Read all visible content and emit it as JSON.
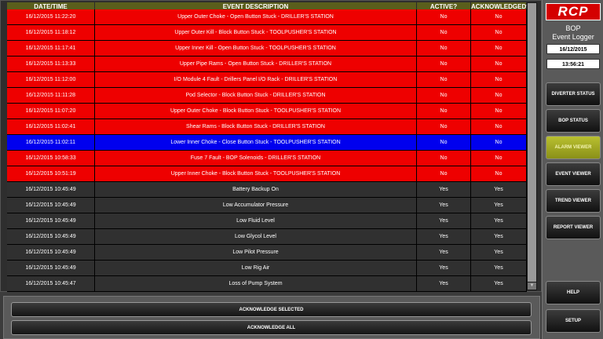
{
  "table": {
    "columns": [
      "DATE/TIME",
      "EVENT DESCRIPTION",
      "ACTIVE?",
      "ACKNOWLEDGED? ▲"
    ],
    "rows": [
      {
        "datetime": "16/12/2015 11:22:20",
        "description": "Upper Outer Choke - Open Button Stuck - DRILLER'S STATION",
        "active": "No",
        "acknowledged": "No",
        "status": "alarm"
      },
      {
        "datetime": "16/12/2015 11:18:12",
        "description": "Upper Outer Kill - Block Button Stuck - TOOLPUSHER'S STATION",
        "active": "No",
        "acknowledged": "No",
        "status": "alarm"
      },
      {
        "datetime": "16/12/2015 11:17:41",
        "description": "Upper Inner Kill - Open Button Stuck - TOOLPUSHER'S STATION",
        "active": "No",
        "acknowledged": "No",
        "status": "alarm"
      },
      {
        "datetime": "16/12/2015 11:13:33",
        "description": "Upper Pipe Rams - Open Button Stuck - DRILLER'S STATION",
        "active": "No",
        "acknowledged": "No",
        "status": "alarm"
      },
      {
        "datetime": "16/12/2015 11:12:00",
        "description": "I/O Module 4 Fault - Drillers Panel I/O Rack - DRILLER'S STATION",
        "active": "No",
        "acknowledged": "No",
        "status": "alarm"
      },
      {
        "datetime": "16/12/2015 11:11:28",
        "description": "Pod Selector - Block Button Stuck - DRILLER'S STATION",
        "active": "No",
        "acknowledged": "No",
        "status": "alarm"
      },
      {
        "datetime": "16/12/2015 11:07:20",
        "description": "Upper Outer Choke - Block Button Stuck - TOOLPUSHER'S STATION",
        "active": "No",
        "acknowledged": "No",
        "status": "alarm"
      },
      {
        "datetime": "16/12/2015 11:02:41",
        "description": "Shear Rams - Block Button Stuck - DRILLER'S STATION",
        "active": "No",
        "acknowledged": "No",
        "status": "alarm"
      },
      {
        "datetime": "16/12/2015 11:02:11",
        "description": "Lower Inner Choke - Close Button Stuck - TOOLPUSHER'S STATION",
        "active": "No",
        "acknowledged": "No",
        "status": "selected"
      },
      {
        "datetime": "16/12/2015 10:58:33",
        "description": "Fuse 7 Fault - BOP Solenoids - DRILLER'S STATION",
        "active": "No",
        "acknowledged": "No",
        "status": "alarm"
      },
      {
        "datetime": "16/12/2015 10:51:19",
        "description": "Upper Inner Choke - Block Button Stuck - TOOLPUSHER'S STATION",
        "active": "No",
        "acknowledged": "No",
        "status": "alarm"
      },
      {
        "datetime": "16/12/2015 10:45:49",
        "description": "Battery Backup On",
        "active": "Yes",
        "acknowledged": "Yes",
        "status": "normal"
      },
      {
        "datetime": "16/12/2015 10:45:49",
        "description": "Low Accumulator Pressure",
        "active": "Yes",
        "acknowledged": "Yes",
        "status": "normal"
      },
      {
        "datetime": "16/12/2015 10:45:49",
        "description": "Low Fluid Level",
        "active": "Yes",
        "acknowledged": "Yes",
        "status": "normal"
      },
      {
        "datetime": "16/12/2015 10:45:49",
        "description": "Low Glycol Level",
        "active": "Yes",
        "acknowledged": "Yes",
        "status": "normal"
      },
      {
        "datetime": "16/12/2015 10:45:49",
        "description": "Low Pilot Pressure",
        "active": "Yes",
        "acknowledged": "Yes",
        "status": "normal"
      },
      {
        "datetime": "16/12/2015 10:45:49",
        "description": "Low Rig Air",
        "active": "Yes",
        "acknowledged": "Yes",
        "status": "normal"
      },
      {
        "datetime": "16/12/2015 10:45:47",
        "description": "Loss of Pump System",
        "active": "Yes",
        "acknowledged": "Yes",
        "status": "normal"
      }
    ]
  },
  "actions": {
    "acknowledge_selected": "ACKNOWLEDGE SELECTED",
    "acknowledge_all": "ACKNOWLEDGE ALL"
  },
  "sidebar": {
    "logo": "RCP",
    "title": "BOP\nEvent Logger",
    "date": "16/12/2015",
    "time": "13:56:21",
    "nav": [
      {
        "label": "DIVERTER STATUS",
        "name": "nav-diverter-status-button",
        "active": false
      },
      {
        "label": "BOP STATUS",
        "name": "nav-bop-status-button",
        "active": false
      },
      {
        "label": "ALARM VIEWER",
        "name": "nav-alarm-viewer-button",
        "active": true
      },
      {
        "label": "EVENT VIEWER",
        "name": "nav-event-viewer-button",
        "active": false
      },
      {
        "label": "TREND VIEWER",
        "name": "nav-trend-viewer-button",
        "active": false
      },
      {
        "label": "REPORT VIEWER",
        "name": "nav-report-viewer-button",
        "active": false
      }
    ],
    "help": "HELP",
    "setup": "SETUP"
  },
  "colors": {
    "alarm_row": "#ee0000",
    "selected_row": "#0000ee",
    "normal_row": "#303030",
    "header": "#5a5e1c",
    "active_nav": "#b9c030",
    "brand": "#d40000"
  }
}
